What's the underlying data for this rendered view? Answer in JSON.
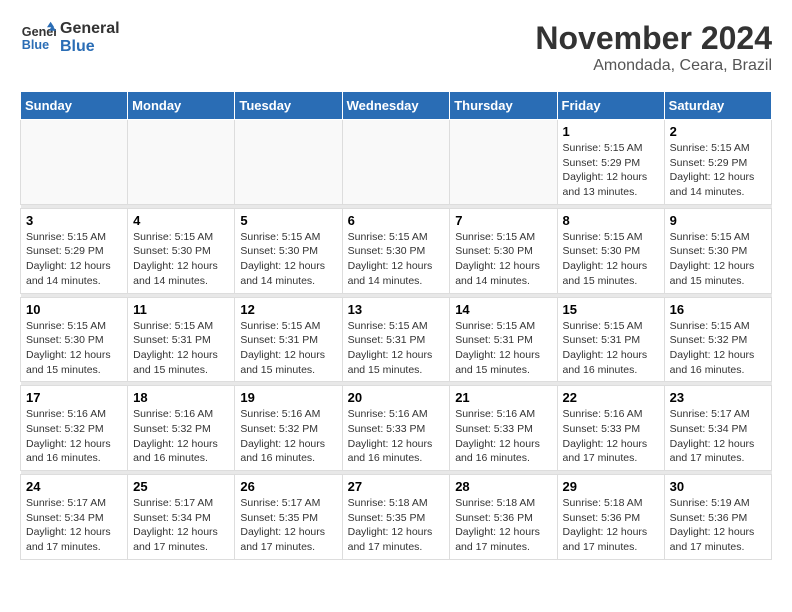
{
  "header": {
    "logo_line1": "General",
    "logo_line2": "Blue",
    "month": "November 2024",
    "location": "Amondada, Ceara, Brazil"
  },
  "weekdays": [
    "Sunday",
    "Monday",
    "Tuesday",
    "Wednesday",
    "Thursday",
    "Friday",
    "Saturday"
  ],
  "weeks": [
    {
      "days": [
        {
          "num": "",
          "info": ""
        },
        {
          "num": "",
          "info": ""
        },
        {
          "num": "",
          "info": ""
        },
        {
          "num": "",
          "info": ""
        },
        {
          "num": "",
          "info": ""
        },
        {
          "num": "1",
          "info": "Sunrise: 5:15 AM\nSunset: 5:29 PM\nDaylight: 12 hours and 13 minutes."
        },
        {
          "num": "2",
          "info": "Sunrise: 5:15 AM\nSunset: 5:29 PM\nDaylight: 12 hours and 14 minutes."
        }
      ]
    },
    {
      "days": [
        {
          "num": "3",
          "info": "Sunrise: 5:15 AM\nSunset: 5:29 PM\nDaylight: 12 hours and 14 minutes."
        },
        {
          "num": "4",
          "info": "Sunrise: 5:15 AM\nSunset: 5:30 PM\nDaylight: 12 hours and 14 minutes."
        },
        {
          "num": "5",
          "info": "Sunrise: 5:15 AM\nSunset: 5:30 PM\nDaylight: 12 hours and 14 minutes."
        },
        {
          "num": "6",
          "info": "Sunrise: 5:15 AM\nSunset: 5:30 PM\nDaylight: 12 hours and 14 minutes."
        },
        {
          "num": "7",
          "info": "Sunrise: 5:15 AM\nSunset: 5:30 PM\nDaylight: 12 hours and 14 minutes."
        },
        {
          "num": "8",
          "info": "Sunrise: 5:15 AM\nSunset: 5:30 PM\nDaylight: 12 hours and 15 minutes."
        },
        {
          "num": "9",
          "info": "Sunrise: 5:15 AM\nSunset: 5:30 PM\nDaylight: 12 hours and 15 minutes."
        }
      ]
    },
    {
      "days": [
        {
          "num": "10",
          "info": "Sunrise: 5:15 AM\nSunset: 5:30 PM\nDaylight: 12 hours and 15 minutes."
        },
        {
          "num": "11",
          "info": "Sunrise: 5:15 AM\nSunset: 5:31 PM\nDaylight: 12 hours and 15 minutes."
        },
        {
          "num": "12",
          "info": "Sunrise: 5:15 AM\nSunset: 5:31 PM\nDaylight: 12 hours and 15 minutes."
        },
        {
          "num": "13",
          "info": "Sunrise: 5:15 AM\nSunset: 5:31 PM\nDaylight: 12 hours and 15 minutes."
        },
        {
          "num": "14",
          "info": "Sunrise: 5:15 AM\nSunset: 5:31 PM\nDaylight: 12 hours and 15 minutes."
        },
        {
          "num": "15",
          "info": "Sunrise: 5:15 AM\nSunset: 5:31 PM\nDaylight: 12 hours and 16 minutes."
        },
        {
          "num": "16",
          "info": "Sunrise: 5:15 AM\nSunset: 5:32 PM\nDaylight: 12 hours and 16 minutes."
        }
      ]
    },
    {
      "days": [
        {
          "num": "17",
          "info": "Sunrise: 5:16 AM\nSunset: 5:32 PM\nDaylight: 12 hours and 16 minutes."
        },
        {
          "num": "18",
          "info": "Sunrise: 5:16 AM\nSunset: 5:32 PM\nDaylight: 12 hours and 16 minutes."
        },
        {
          "num": "19",
          "info": "Sunrise: 5:16 AM\nSunset: 5:32 PM\nDaylight: 12 hours and 16 minutes."
        },
        {
          "num": "20",
          "info": "Sunrise: 5:16 AM\nSunset: 5:33 PM\nDaylight: 12 hours and 16 minutes."
        },
        {
          "num": "21",
          "info": "Sunrise: 5:16 AM\nSunset: 5:33 PM\nDaylight: 12 hours and 16 minutes."
        },
        {
          "num": "22",
          "info": "Sunrise: 5:16 AM\nSunset: 5:33 PM\nDaylight: 12 hours and 17 minutes."
        },
        {
          "num": "23",
          "info": "Sunrise: 5:17 AM\nSunset: 5:34 PM\nDaylight: 12 hours and 17 minutes."
        }
      ]
    },
    {
      "days": [
        {
          "num": "24",
          "info": "Sunrise: 5:17 AM\nSunset: 5:34 PM\nDaylight: 12 hours and 17 minutes."
        },
        {
          "num": "25",
          "info": "Sunrise: 5:17 AM\nSunset: 5:34 PM\nDaylight: 12 hours and 17 minutes."
        },
        {
          "num": "26",
          "info": "Sunrise: 5:17 AM\nSunset: 5:35 PM\nDaylight: 12 hours and 17 minutes."
        },
        {
          "num": "27",
          "info": "Sunrise: 5:18 AM\nSunset: 5:35 PM\nDaylight: 12 hours and 17 minutes."
        },
        {
          "num": "28",
          "info": "Sunrise: 5:18 AM\nSunset: 5:36 PM\nDaylight: 12 hours and 17 minutes."
        },
        {
          "num": "29",
          "info": "Sunrise: 5:18 AM\nSunset: 5:36 PM\nDaylight: 12 hours and 17 minutes."
        },
        {
          "num": "30",
          "info": "Sunrise: 5:19 AM\nSunset: 5:36 PM\nDaylight: 12 hours and 17 minutes."
        }
      ]
    }
  ]
}
